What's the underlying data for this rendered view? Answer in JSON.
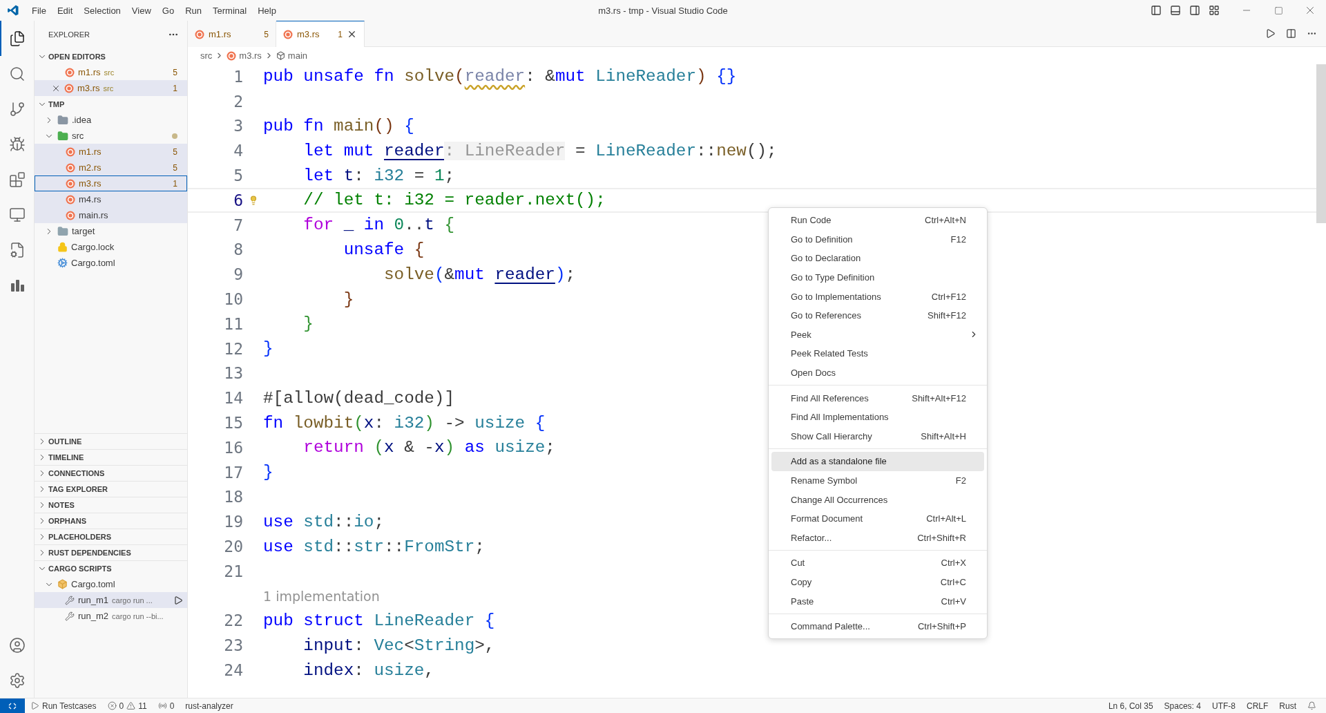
{
  "title_bar": {
    "menus": [
      "File",
      "Edit",
      "Selection",
      "View",
      "Go",
      "Run",
      "Terminal",
      "Help"
    ],
    "title": "m3.rs - tmp - Visual Studio Code"
  },
  "activity_bar": {
    "items": [
      {
        "kind": "files",
        "selected": true
      },
      {
        "kind": "search",
        "selected": false
      },
      {
        "kind": "source-control",
        "selected": false
      },
      {
        "kind": "run-debug",
        "selected": false
      },
      {
        "kind": "extensions",
        "selected": false
      },
      {
        "kind": "remote",
        "selected": false
      },
      {
        "kind": "tests",
        "selected": false
      },
      {
        "kind": "chart",
        "selected": false
      }
    ],
    "bottom": [
      {
        "kind": "account"
      },
      {
        "kind": "settings"
      }
    ]
  },
  "sidebar": {
    "title": "EXPLORER",
    "open_editors": {
      "label": "OPEN EDITORS",
      "expanded": true,
      "items": [
        {
          "name": "m1.rs",
          "description": "src",
          "badge": "5",
          "selected": false
        },
        {
          "name": "m3.rs",
          "description": "src",
          "badge": "1",
          "selected": true
        }
      ]
    },
    "folder": {
      "label": "TMP",
      "expanded": true,
      "children": [
        {
          "name": ".idea",
          "kind": "folder-idea",
          "expanded": false,
          "modified": false
        },
        {
          "name": "src",
          "kind": "folder-src",
          "expanded": true,
          "modified": true,
          "children": [
            {
              "name": "m1.rs",
              "kind": "rust",
              "badge": "5",
              "selected": false,
              "highlighted": true
            },
            {
              "name": "m2.rs",
              "kind": "rust",
              "badge": "5",
              "selected": false,
              "highlighted": true
            },
            {
              "name": "m3.rs",
              "kind": "rust",
              "badge": "1",
              "selected": true,
              "highlighted": true
            },
            {
              "name": "m4.rs",
              "kind": "rust",
              "selected": false,
              "highlighted": true
            },
            {
              "name": "main.rs",
              "kind": "rust",
              "selected": false,
              "highlighted": true
            }
          ]
        },
        {
          "name": "target",
          "kind": "folder",
          "expanded": false,
          "modified": false
        },
        {
          "name": "Cargo.lock",
          "kind": "lock",
          "selected": false,
          "highlighted": false
        },
        {
          "name": "Cargo.toml",
          "kind": "gear",
          "selected": false,
          "highlighted": false
        }
      ]
    },
    "panels": [
      {
        "label": "OUTLINE",
        "expanded": false
      },
      {
        "label": "TIMELINE",
        "expanded": false
      },
      {
        "label": "CONNECTIONS",
        "expanded": false
      },
      {
        "label": "TAG EXPLORER",
        "expanded": false
      },
      {
        "label": "NOTES",
        "expanded": false
      },
      {
        "label": "ORPHANS",
        "expanded": false
      },
      {
        "label": "PLACEHOLDERS",
        "expanded": false
      },
      {
        "label": "RUST DEPENDENCIES",
        "expanded": false
      }
    ],
    "cargo_scripts": {
      "label": "CARGO SCRIPTS",
      "expanded": true,
      "file": {
        "name": "Cargo.toml",
        "expanded": true
      },
      "scripts": [
        {
          "name": "run_m1",
          "description": "cargo run ...",
          "selected": true
        },
        {
          "name": "run_m2",
          "description": "cargo run --bi...",
          "selected": false
        }
      ]
    }
  },
  "tabs": [
    {
      "label": "m1.rs",
      "badge": "5",
      "selected": false
    },
    {
      "label": "m3.rs",
      "badge": "1",
      "selected": true
    }
  ],
  "breadcrumbs": [
    {
      "label": "src",
      "kind": "folder"
    },
    {
      "label": "m3.rs",
      "kind": "file"
    },
    {
      "label": "main",
      "kind": "symbol"
    }
  ],
  "editor": {
    "lines": [
      {
        "kind": "code",
        "number": "1",
        "current": false,
        "tokens": [
          {
            "text": "pub ",
            "kind": "kw"
          },
          {
            "text": "unsafe ",
            "kind": "kw"
          },
          {
            "text": "fn ",
            "kind": "kw"
          },
          {
            "text": "solve",
            "kind": "fn"
          },
          {
            "text": "(",
            "kind": "b3"
          },
          {
            "text": "reader",
            "kind": "unused"
          },
          {
            "text": ": &",
            "kind": "p"
          },
          {
            "text": "mut ",
            "kind": "kw"
          },
          {
            "text": "LineReader",
            "kind": "type"
          },
          {
            "text": ") ",
            "kind": "b3"
          },
          {
            "text": "{}",
            "kind": "b1"
          }
        ]
      },
      {
        "kind": "code",
        "number": "2",
        "current": false
      },
      {
        "kind": "code",
        "number": "3",
        "current": false,
        "tokens": [
          {
            "text": "pub ",
            "kind": "kw"
          },
          {
            "text": "fn ",
            "kind": "kw"
          },
          {
            "text": "main",
            "kind": "fn"
          },
          {
            "text": "() ",
            "kind": "b3"
          },
          {
            "text": "{",
            "kind": "b1"
          }
        ]
      },
      {
        "kind": "code",
        "number": "4",
        "current": false,
        "tokens": [
          {
            "text": "    let ",
            "kind": "kw"
          },
          {
            "text": "mut ",
            "kind": "kw"
          },
          {
            "text": "reader",
            "kind": "mutvar"
          },
          {
            "text": ": LineReader",
            "kind": "hint"
          },
          {
            "text": " = ",
            "kind": "p"
          },
          {
            "text": "LineReader",
            "kind": "type"
          },
          {
            "text": "::",
            "kind": "p"
          },
          {
            "text": "new",
            "kind": "fn"
          },
          {
            "text": "();",
            "kind": "p"
          }
        ]
      },
      {
        "kind": "code",
        "number": "5",
        "current": false,
        "tokens": [
          {
            "text": "    let ",
            "kind": "kw"
          },
          {
            "text": "t",
            "kind": "var"
          },
          {
            "text": ": ",
            "kind": "p"
          },
          {
            "text": "i32",
            "kind": "type"
          },
          {
            "text": " = ",
            "kind": "p"
          },
          {
            "text": "1",
            "kind": "num"
          },
          {
            "text": ";",
            "kind": "p"
          }
        ]
      },
      {
        "kind": "code",
        "number": "6",
        "current": true,
        "tokens": [
          {
            "text": "    // let t: i32 = reader.next();",
            "kind": "comment"
          }
        ]
      },
      {
        "kind": "code",
        "number": "7",
        "current": false,
        "tokens": [
          {
            "text": "    for ",
            "kind": "ctrl"
          },
          {
            "text": "_ ",
            "kind": "var"
          },
          {
            "text": "in ",
            "kind": "kw"
          },
          {
            "text": "0",
            "kind": "num"
          },
          {
            "text": "..",
            "kind": "p"
          },
          {
            "text": "t ",
            "kind": "var"
          },
          {
            "text": "{",
            "kind": "b2"
          }
        ]
      },
      {
        "kind": "code",
        "number": "8",
        "current": false,
        "tokens": [
          {
            "text": "        unsafe ",
            "kind": "kw"
          },
          {
            "text": "{",
            "kind": "b3"
          }
        ]
      },
      {
        "kind": "code",
        "number": "9",
        "current": false,
        "tokens": [
          {
            "text": "            solve",
            "kind": "fn"
          },
          {
            "text": "(",
            "kind": "b1"
          },
          {
            "text": "&",
            "kind": "p"
          },
          {
            "text": "mut ",
            "kind": "kw"
          },
          {
            "text": "reader",
            "kind": "mutvar"
          },
          {
            "text": ")",
            "kind": "b1"
          },
          {
            "text": ";",
            "kind": "p"
          }
        ]
      },
      {
        "kind": "code",
        "number": "10",
        "current": false,
        "tokens": [
          {
            "text": "        }",
            "kind": "b3"
          }
        ]
      },
      {
        "kind": "code",
        "number": "11",
        "current": false,
        "tokens": [
          {
            "text": "    }",
            "kind": "b2"
          }
        ]
      },
      {
        "kind": "code",
        "number": "12",
        "current": false,
        "tokens": [
          {
            "text": "}",
            "kind": "b1"
          }
        ]
      },
      {
        "kind": "code",
        "number": "13",
        "current": false
      },
      {
        "kind": "code",
        "number": "14",
        "current": false,
        "tokens": [
          {
            "text": "#[allow(dead_code)]",
            "kind": "p"
          }
        ]
      },
      {
        "kind": "code",
        "number": "15",
        "current": false,
        "tokens": [
          {
            "text": "fn ",
            "kind": "kw"
          },
          {
            "text": "lowbit",
            "kind": "fn"
          },
          {
            "text": "(",
            "kind": "b2"
          },
          {
            "text": "x",
            "kind": "var"
          },
          {
            "text": ": ",
            "kind": "p"
          },
          {
            "text": "i32",
            "kind": "type"
          },
          {
            "text": ")",
            "kind": "b2"
          },
          {
            "text": " -> ",
            "kind": "p"
          },
          {
            "text": "usize ",
            "kind": "type"
          },
          {
            "text": "{",
            "kind": "b1"
          }
        ]
      },
      {
        "kind": "code",
        "number": "16",
        "current": false,
        "tokens": [
          {
            "text": "    return ",
            "kind": "ctrl"
          },
          {
            "text": "(",
            "kind": "b2"
          },
          {
            "text": "x",
            "kind": "var"
          },
          {
            "text": " & -",
            "kind": "p"
          },
          {
            "text": "x",
            "kind": "var"
          },
          {
            "text": ") ",
            "kind": "b2"
          },
          {
            "text": "as ",
            "kind": "kw"
          },
          {
            "text": "usize",
            "kind": "type"
          },
          {
            "text": ";",
            "kind": "p"
          }
        ]
      },
      {
        "kind": "code",
        "number": "17",
        "current": false,
        "tokens": [
          {
            "text": "}",
            "kind": "b1"
          }
        ]
      },
      {
        "kind": "code",
        "number": "18",
        "current": false
      },
      {
        "kind": "code",
        "number": "19",
        "current": false,
        "tokens": [
          {
            "text": "use ",
            "kind": "kw"
          },
          {
            "text": "std",
            "kind": "type"
          },
          {
            "text": "::",
            "kind": "p"
          },
          {
            "text": "io",
            "kind": "type"
          },
          {
            "text": ";",
            "kind": "p"
          }
        ]
      },
      {
        "kind": "code",
        "number": "20",
        "current": false,
        "tokens": [
          {
            "text": "use ",
            "kind": "kw"
          },
          {
            "text": "std",
            "kind": "type"
          },
          {
            "text": "::",
            "kind": "p"
          },
          {
            "text": "str",
            "kind": "type"
          },
          {
            "text": "::",
            "kind": "p"
          },
          {
            "text": "FromStr",
            "kind": "type"
          },
          {
            "text": ";",
            "kind": "p"
          }
        ]
      },
      {
        "kind": "code",
        "number": "21",
        "current": false
      },
      {
        "kind": "codelens",
        "text": "1 implementation"
      },
      {
        "kind": "code",
        "number": "22",
        "current": false,
        "tokens": [
          {
            "text": "pub ",
            "kind": "kw"
          },
          {
            "text": "struct ",
            "kind": "kw"
          },
          {
            "text": "LineReader ",
            "kind": "type"
          },
          {
            "text": "{",
            "kind": "b1"
          }
        ]
      },
      {
        "kind": "code",
        "number": "23",
        "current": false,
        "tokens": [
          {
            "text": "    input",
            "kind": "var"
          },
          {
            "text": ": ",
            "kind": "p"
          },
          {
            "text": "Vec",
            "kind": "type"
          },
          {
            "text": "<",
            "kind": "p"
          },
          {
            "text": "String",
            "kind": "type"
          },
          {
            "text": ">,",
            "kind": "p"
          }
        ]
      },
      {
        "kind": "code",
        "number": "24",
        "current": false,
        "tokens": [
          {
            "text": "    index",
            "kind": "var"
          },
          {
            "text": ": ",
            "kind": "p"
          },
          {
            "text": "usize",
            "kind": "type"
          },
          {
            "text": ",",
            "kind": "p"
          }
        ]
      }
    ]
  },
  "context_menu": {
    "groups": [
      [
        {
          "label": "Run Code",
          "shortcut": "Ctrl+Alt+N",
          "submenu": false,
          "selected": false
        },
        {
          "label": "Go to Definition",
          "shortcut": "F12",
          "submenu": false,
          "selected": false
        },
        {
          "label": "Go to Declaration",
          "submenu": false,
          "selected": false
        },
        {
          "label": "Go to Type Definition",
          "submenu": false,
          "selected": false
        },
        {
          "label": "Go to Implementations",
          "shortcut": "Ctrl+F12",
          "submenu": false,
          "selected": false
        },
        {
          "label": "Go to References",
          "shortcut": "Shift+F12",
          "submenu": false,
          "selected": false
        },
        {
          "label": "Peek",
          "submenu": true,
          "selected": false
        },
        {
          "label": "Peek Related Tests",
          "submenu": false,
          "selected": false
        },
        {
          "label": "Open Docs",
          "submenu": false,
          "selected": false
        }
      ],
      [
        {
          "label": "Find All References",
          "shortcut": "Shift+Alt+F12",
          "submenu": false,
          "selected": false
        },
        {
          "label": "Find All Implementations",
          "submenu": false,
          "selected": false
        },
        {
          "label": "Show Call Hierarchy",
          "shortcut": "Shift+Alt+H",
          "submenu": false,
          "selected": false
        }
      ],
      [
        {
          "label": "Add as a standalone file",
          "submenu": false,
          "selected": true
        },
        {
          "label": "Rename Symbol",
          "shortcut": "F2",
          "submenu": false,
          "selected": false
        },
        {
          "label": "Change All Occurrences",
          "submenu": false,
          "selected": false
        },
        {
          "label": "Format Document",
          "shortcut": "Ctrl+Alt+L",
          "submenu": false,
          "selected": false
        },
        {
          "label": "Refactor...",
          "shortcut": "Ctrl+Shift+R",
          "submenu": false,
          "selected": false
        }
      ],
      [
        {
          "label": "Cut",
          "shortcut": "Ctrl+X",
          "submenu": false,
          "selected": false
        },
        {
          "label": "Copy",
          "shortcut": "Ctrl+C",
          "submenu": false,
          "selected": false
        },
        {
          "label": "Paste",
          "shortcut": "Ctrl+V",
          "submenu": false,
          "selected": false
        }
      ],
      [
        {
          "label": "Command Palette...",
          "shortcut": "Ctrl+Shift+P",
          "submenu": false,
          "selected": false
        }
      ]
    ]
  },
  "status_bar": {
    "left": {
      "run": "Run Testcases",
      "errors": "0",
      "warnings": "11",
      "ports": "0",
      "server": "rust-analyzer"
    },
    "right": [
      "Ln 6, Col 35",
      "Spaces: 4",
      "UTF-8",
      "CRLF",
      "Rust"
    ]
  }
}
